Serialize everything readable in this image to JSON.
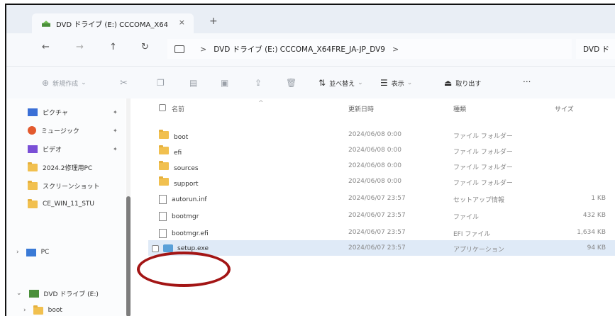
{
  "tab": {
    "title": "DVD ドライブ (E:) CCCOMA_X64",
    "close": "×",
    "new": "+"
  },
  "address": {
    "separator": ">",
    "path": "DVD ドライブ (E:) CCCOMA_X64FRE_JA-JP_DV9",
    "trail": ">",
    "search_text": "DVD ド"
  },
  "toolbar": {
    "new": "新規作成",
    "sort": "並べ替え",
    "view": "表示",
    "eject": "取り出す",
    "more": "..."
  },
  "nav_items": [
    {
      "label": "ピクチャ",
      "pinned": true
    },
    {
      "label": "ミュージック",
      "pinned": true
    },
    {
      "label": "ビデオ",
      "pinned": true
    },
    {
      "label": "2024.2修理用PC",
      "pinned": false
    },
    {
      "label": "スクリーンショット",
      "pinned": false
    },
    {
      "label": "CE_WIN_11_STU",
      "pinned": false
    },
    {
      "label": "PC",
      "pinned": false
    },
    {
      "label": "DVD ドライブ (E:)",
      "pinned": false
    },
    {
      "label": "boot",
      "pinned": false
    }
  ],
  "columns": {
    "name": "名前",
    "date": "更新日時",
    "type": "種類",
    "size": "サイズ"
  },
  "files": [
    {
      "name": "boot",
      "date": "2024/06/08 0:00",
      "type": "ファイル フォルダー",
      "size": ""
    },
    {
      "name": "efi",
      "date": "2024/06/08 0:00",
      "type": "ファイル フォルダー",
      "size": ""
    },
    {
      "name": "sources",
      "date": "2024/06/08 0:00",
      "type": "ファイル フォルダー",
      "size": ""
    },
    {
      "name": "support",
      "date": "2024/06/08 0:00",
      "type": "ファイル フォルダー",
      "size": ""
    },
    {
      "name": "autorun.inf",
      "date": "2024/06/07 23:57",
      "type": "セットアップ情報",
      "size": "1 KB"
    },
    {
      "name": "bootmgr",
      "date": "2024/06/07 23:57",
      "type": "ファイル",
      "size": "432 KB"
    },
    {
      "name": "bootmgr.efi",
      "date": "2024/06/07 23:57",
      "type": "EFI ファイル",
      "size": "1,634 KB"
    },
    {
      "name": "setup.exe",
      "date": "2024/06/07 23:57",
      "type": "アプリケーション",
      "size": "94 KB"
    }
  ],
  "colors": {
    "highlight_circle": "#a31515",
    "selected_row": "#dfeaf7"
  }
}
